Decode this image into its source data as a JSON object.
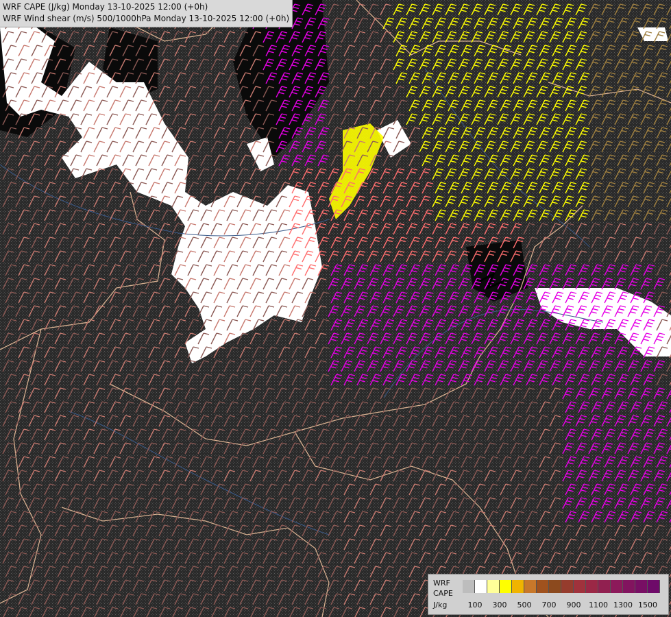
{
  "header": {
    "line1": "WRF CAPE (J/kg) Monday 13-10-2025 12:00 (+0h)",
    "line2": "WRF Wind shear (m/s) 500/1000hPa Monday 13-10-2025 12:00 (+0h)"
  },
  "legend": {
    "label_line1": "WRF",
    "label_line2": "CAPE",
    "label_line3": "J/kg",
    "colors": [
      "#bdbdbd",
      "#ffffff",
      "#ffff99",
      "#ffff00",
      "#f0b400",
      "#c8782a",
      "#a0521e",
      "#8c4a1e",
      "#963c2d",
      "#a0323c",
      "#9b2846",
      "#912050",
      "#8c1a5a",
      "#82145f",
      "#780f64",
      "#6e0a69"
    ],
    "ticks": [
      "100",
      "300",
      "500",
      "700",
      "900",
      "1100",
      "1300",
      "1500"
    ]
  },
  "map": {
    "barb_colors": {
      "weak": "#8c5a55",
      "mid": "#c87a70",
      "strong_pink": "#ff6e6e",
      "magenta": "#e600e6",
      "yellow": "#ffff00",
      "tan": "#a08040"
    },
    "cape_colors": {
      "none": "#1a1a1a",
      "low": "#ffffff",
      "black": "#000000"
    }
  }
}
